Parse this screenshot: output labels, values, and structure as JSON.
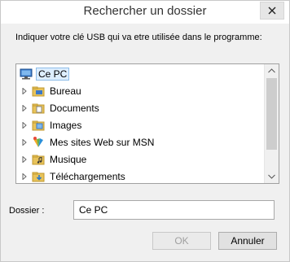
{
  "dialog": {
    "title": "Rechercher un dossier",
    "instruction": "Indiquer votre clé USB qui va etre utilisée dans le programme:"
  },
  "tree": {
    "root": {
      "label": "Ce PC",
      "icon": "computer-icon",
      "selected": true,
      "expanded": true
    },
    "items": [
      {
        "label": "Bureau",
        "icon": "desktop-folder-icon"
      },
      {
        "label": "Documents",
        "icon": "documents-folder-icon"
      },
      {
        "label": "Images",
        "icon": "pictures-folder-icon"
      },
      {
        "label": "Mes sites Web sur MSN",
        "icon": "msn-icon"
      },
      {
        "label": "Musique",
        "icon": "music-folder-icon"
      },
      {
        "label": "Téléchargements",
        "icon": "downloads-folder-icon"
      }
    ]
  },
  "folder": {
    "label": "Dossier :",
    "value": "Ce PC"
  },
  "buttons": {
    "ok": "OK",
    "cancel": "Annuler"
  },
  "colors": {
    "folder": "#e8c35a",
    "selection": "#ddeeff",
    "accent": "#2a78c8"
  }
}
